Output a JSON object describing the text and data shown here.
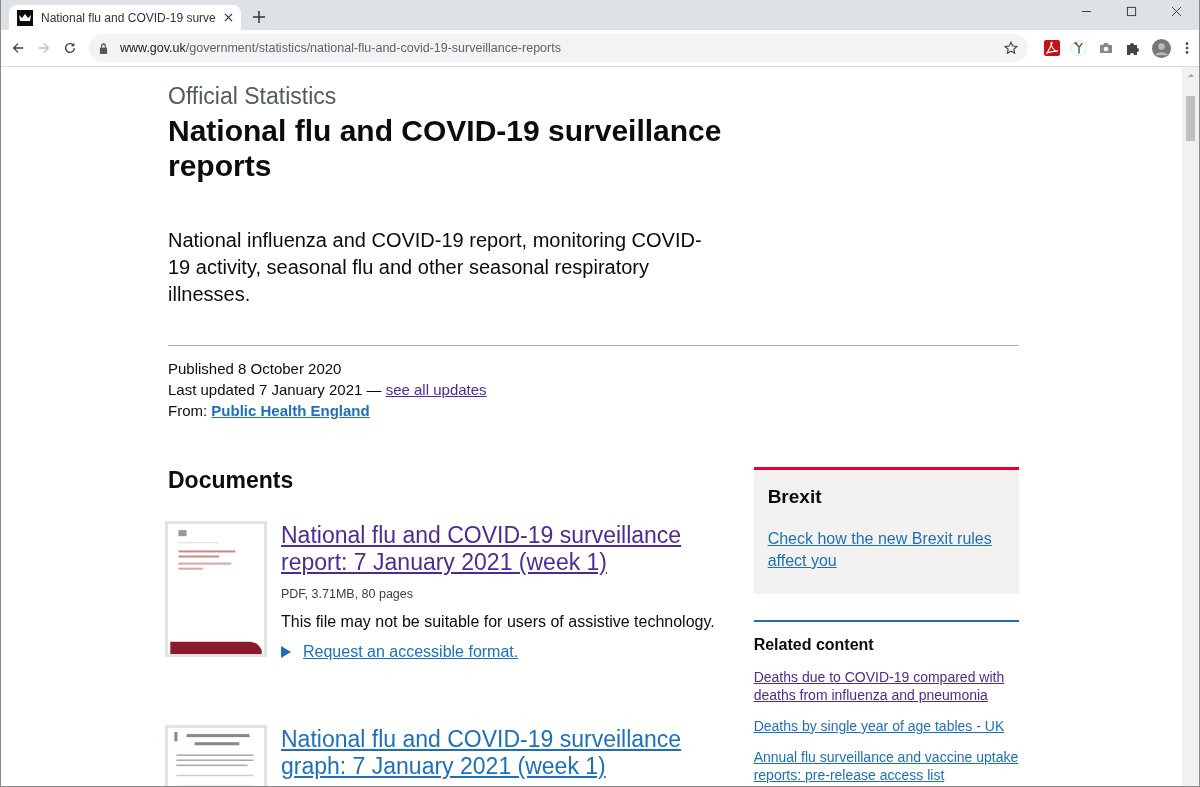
{
  "browser": {
    "tab": {
      "title": "National flu and COVID-19 surve"
    },
    "address": {
      "host": "www.gov.uk",
      "path": "/government/statistics/national-flu-and-covid-19-surveillance-reports"
    }
  },
  "page": {
    "category": "Official Statistics",
    "title": "National flu and COVID-19 surveillance reports",
    "summary": "National influenza and COVID-19 report, monitoring COVID-19 activity, seasonal flu and other seasonal respiratory illnesses.",
    "published": "Published 8 October 2020",
    "updated": {
      "text": "Last updated 7 January 2021 —",
      "link": {
        "text": "see all updates",
        "visited": true
      }
    },
    "from": {
      "label": "From:",
      "link": {
        "text": "Public Health England",
        "visited": false
      }
    },
    "documents": {
      "heading": "Documents",
      "items": [
        {
          "title": "National flu and COVID-19 surveillance report: 7 January 2021 (week 1)",
          "visited": true,
          "meta": "PDF, 3.71MB, 80 pages",
          "warning": "This file may not be suitable for users of assistive technology.",
          "request": "Request an accessible format."
        },
        {
          "title": "National flu and COVID-19 surveillance graph: 7 January 2021 (week 1)",
          "visited": false
        }
      ]
    }
  },
  "sidebar": {
    "brexit": {
      "heading": "Brexit",
      "link": {
        "text": "Check how the new Brexit rules affect you",
        "visited": false
      }
    },
    "related": {
      "heading": "Related content",
      "links": [
        {
          "text": "Deaths due to COVID-19 compared with deaths from influenza and pneumonia",
          "visited": true
        },
        {
          "text": "Deaths by single year of age tables - UK",
          "visited": false
        },
        {
          "text": "Annual flu surveillance and vaccine uptake reports: pre-release access list",
          "visited": false
        }
      ]
    }
  }
}
